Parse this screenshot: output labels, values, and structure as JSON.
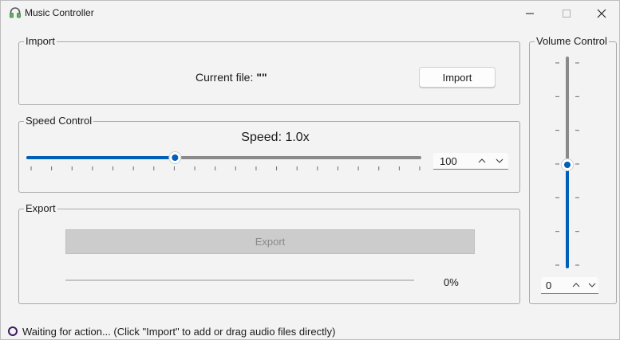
{
  "window": {
    "title": "Music Controller",
    "app_icon": "headphones-icon"
  },
  "import": {
    "group_label": "Import",
    "current_file_label": "Current file:",
    "current_file_value": "\"\"",
    "import_button": "Import"
  },
  "speed": {
    "group_label": "Speed Control",
    "speed_text": "Speed: 1.0x",
    "slider_value": 100,
    "slider_min": 50,
    "slider_max": 200,
    "spin_value": "100"
  },
  "export": {
    "group_label": "Export",
    "export_button": "Export",
    "progress": 0,
    "progress_text": "0%"
  },
  "volume": {
    "group_label": "Volume Control",
    "slider_value": 50,
    "spin_value": "0"
  },
  "status": {
    "text": "Waiting for action... (Click \"Import\" to add or drag audio files directly)"
  },
  "colors": {
    "accent": "#005fb8",
    "track": "#8a8a8a",
    "background": "#f3f3f3"
  }
}
